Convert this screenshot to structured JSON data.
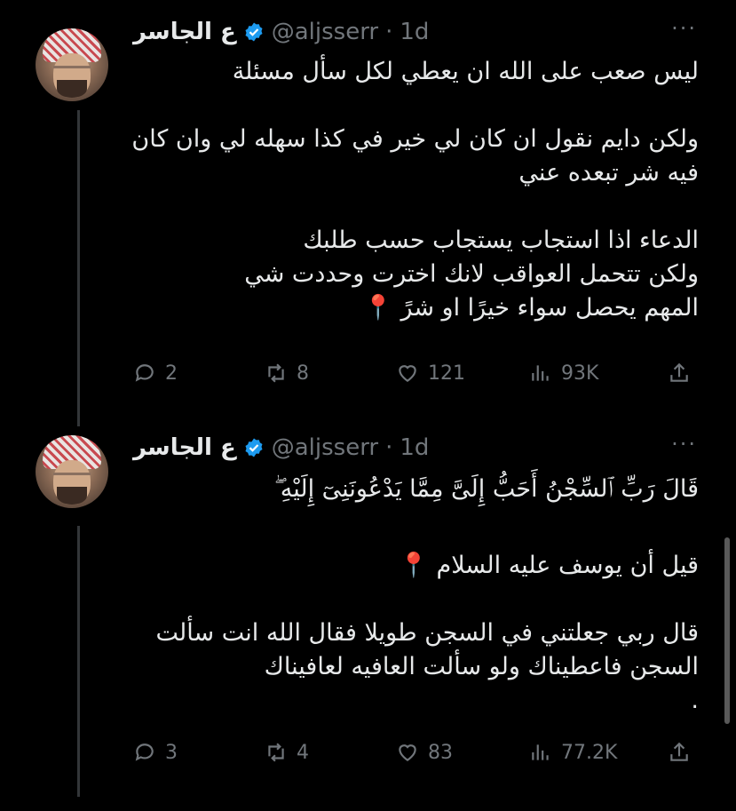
{
  "tweets": [
    {
      "display_name": "ع الجاسر",
      "handle": "@aljsserr",
      "dot": "·",
      "time": "1d",
      "more": "···",
      "body": [
        "ليس صعب على الله ان يعطي لكل سأل مسئلة",
        "",
        "ولكن دايم نقول ان كان لي خير في كذا سهله لي وان كان فيه شر تبعده عني",
        "",
        "الدعاء اذا استجاب يستجاب حسب طلبك",
        "ولكن تتحمل العواقب لانك اخترت وحددت شي",
        "المهم يحصل سواء خيرًا او شرً 📍"
      ],
      "replies": "2",
      "reposts": "8",
      "likes": "121",
      "views": "93K"
    },
    {
      "display_name": "ع الجاسر",
      "handle": "@aljsserr",
      "dot": "·",
      "time": "1d",
      "more": "···",
      "body": [
        "قَالَ رَبِّ ٱلسِّجْنُ أَحَبُّ إِلَىَّ مِمَّا يَدْعُونَنِىٓ إِلَيْهِ ۖ",
        "",
        "قيل أن يوسف عليه السلام 📍",
        "",
        "قال ربي جعلتني في السجن طويلا فقال الله انت سألت السجن فاعطيناك ولو سألت العافيه لعافيناك",
        "."
      ],
      "replies": "3",
      "reposts": "4",
      "likes": "83",
      "views": "77.2K"
    }
  ],
  "icons": {
    "reply": "reply-icon",
    "repost": "repost-icon",
    "like": "heart-icon",
    "views": "views-icon",
    "share": "share-icon",
    "verified": "verified-badge-icon"
  },
  "colors": {
    "background": "#000000",
    "text": "#e7e9ea",
    "muted": "#71767b",
    "verified": "#1d9bf0",
    "thread_line": "#333639"
  }
}
